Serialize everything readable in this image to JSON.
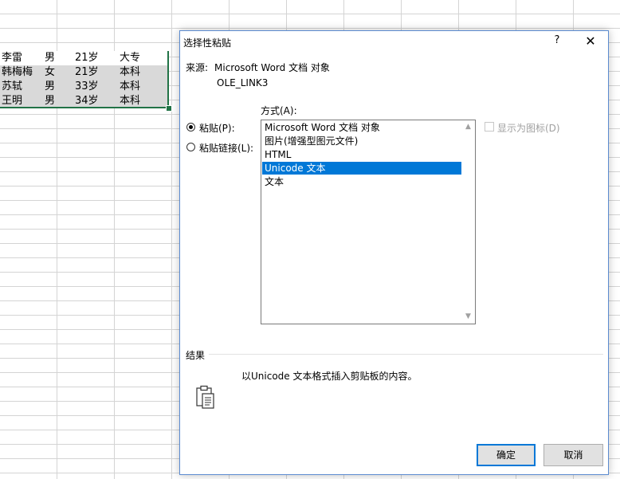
{
  "sheet": {
    "rows": [
      [
        "李雷",
        "男",
        "21岁",
        "大专"
      ],
      [
        "韩梅梅",
        "女",
        "21岁",
        "本科"
      ],
      [
        "苏轼",
        "男",
        "33岁",
        "本科"
      ],
      [
        "王明",
        "男",
        "34岁",
        "本科"
      ]
    ]
  },
  "dialog": {
    "title": "选择性粘贴",
    "help": "?",
    "close": "✕",
    "source_label": "来源:",
    "source_value": "Microsoft Word 文档 对象",
    "source_link": "OLE_LINK3",
    "as_label": "方式(A):",
    "paste_label": "粘贴(P):",
    "paste_link_label": "粘贴链接(L):",
    "formats": [
      "Microsoft Word 文档 对象",
      "图片(增强型图元文件)",
      "HTML",
      "Unicode 文本",
      "文本"
    ],
    "selected_format": "Unicode 文本",
    "display_as_icon": "显示为图标(D)",
    "result_label": "结果",
    "result_text": "以Unicode 文本格式插入剪贴板的内容。",
    "ok": "确定",
    "cancel": "取消"
  },
  "colors": {
    "accent": "#0078d7",
    "selection_border": "#217346"
  }
}
